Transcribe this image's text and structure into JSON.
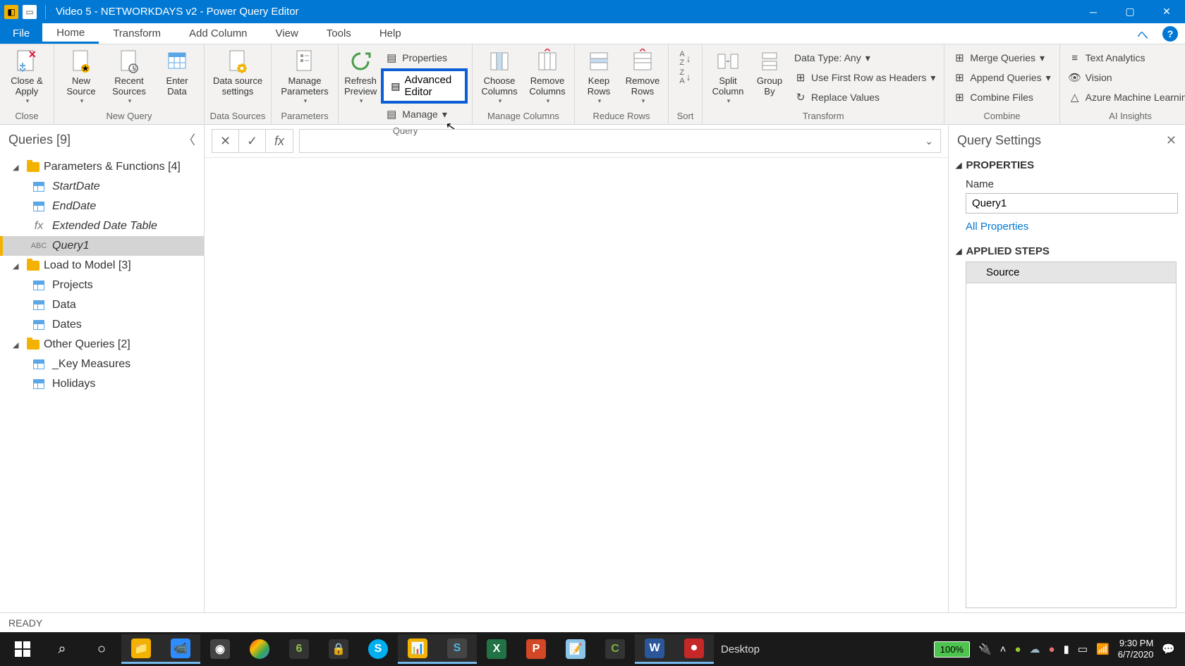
{
  "title": "Video 5 - NETWORKDAYS v2 - Power Query Editor",
  "menu": {
    "file": "File",
    "home": "Home",
    "transform": "Transform",
    "addcol": "Add Column",
    "view": "View",
    "tools": "Tools",
    "help": "Help"
  },
  "ribbon": {
    "close_apply": "Close &\nApply",
    "close_group": "Close",
    "new_source": "New\nSource",
    "recent_sources": "Recent\nSources",
    "enter_data": "Enter\nData",
    "newquery_group": "New Query",
    "data_source_settings": "Data source\nsettings",
    "datasources_group": "Data Sources",
    "manage_parameters": "Manage\nParameters",
    "parameters_group": "Parameters",
    "refresh_preview": "Refresh\nPreview",
    "properties": "Properties",
    "advanced_editor": "Advanced Editor",
    "manage": "Manage",
    "query_group": "Query",
    "choose_columns": "Choose\nColumns",
    "remove_columns": "Remove\nColumns",
    "managecols_group": "Manage Columns",
    "keep_rows": "Keep\nRows",
    "remove_rows": "Remove\nRows",
    "reducerows_group": "Reduce Rows",
    "sort_group": "Sort",
    "split_column": "Split\nColumn",
    "group_by": "Group\nBy",
    "data_type": "Data Type: Any",
    "first_row_headers": "Use First Row as Headers",
    "replace_values": "Replace Values",
    "transform_group": "Transform",
    "merge_queries": "Merge Queries",
    "append_queries": "Append Queries",
    "combine_files": "Combine Files",
    "combine_group": "Combine",
    "text_analytics": "Text Analytics",
    "vision": "Vision",
    "azure_ml": "Azure Machine Learning",
    "ai_group": "AI Insights"
  },
  "queries": {
    "header": "Queries [9]",
    "folder1": "Parameters & Functions [4]",
    "startdate": "StartDate",
    "enddate": "EndDate",
    "extdate": "Extended Date Table",
    "query1": "Query1",
    "folder2": "Load to Model [3]",
    "projects": "Projects",
    "data": "Data",
    "dates": "Dates",
    "folder3": "Other Queries [2]",
    "keymeasures": "_Key Measures",
    "holidays": "Holidays"
  },
  "settings": {
    "header": "Query Settings",
    "properties": "PROPERTIES",
    "name_label": "Name",
    "name_value": "Query1",
    "all_properties": "All Properties",
    "applied_steps": "APPLIED STEPS",
    "step_source": "Source"
  },
  "status": "READY",
  "taskbar": {
    "desktop": "Desktop",
    "battery": "100%",
    "time": "9:30 PM",
    "date": "6/7/2020"
  }
}
